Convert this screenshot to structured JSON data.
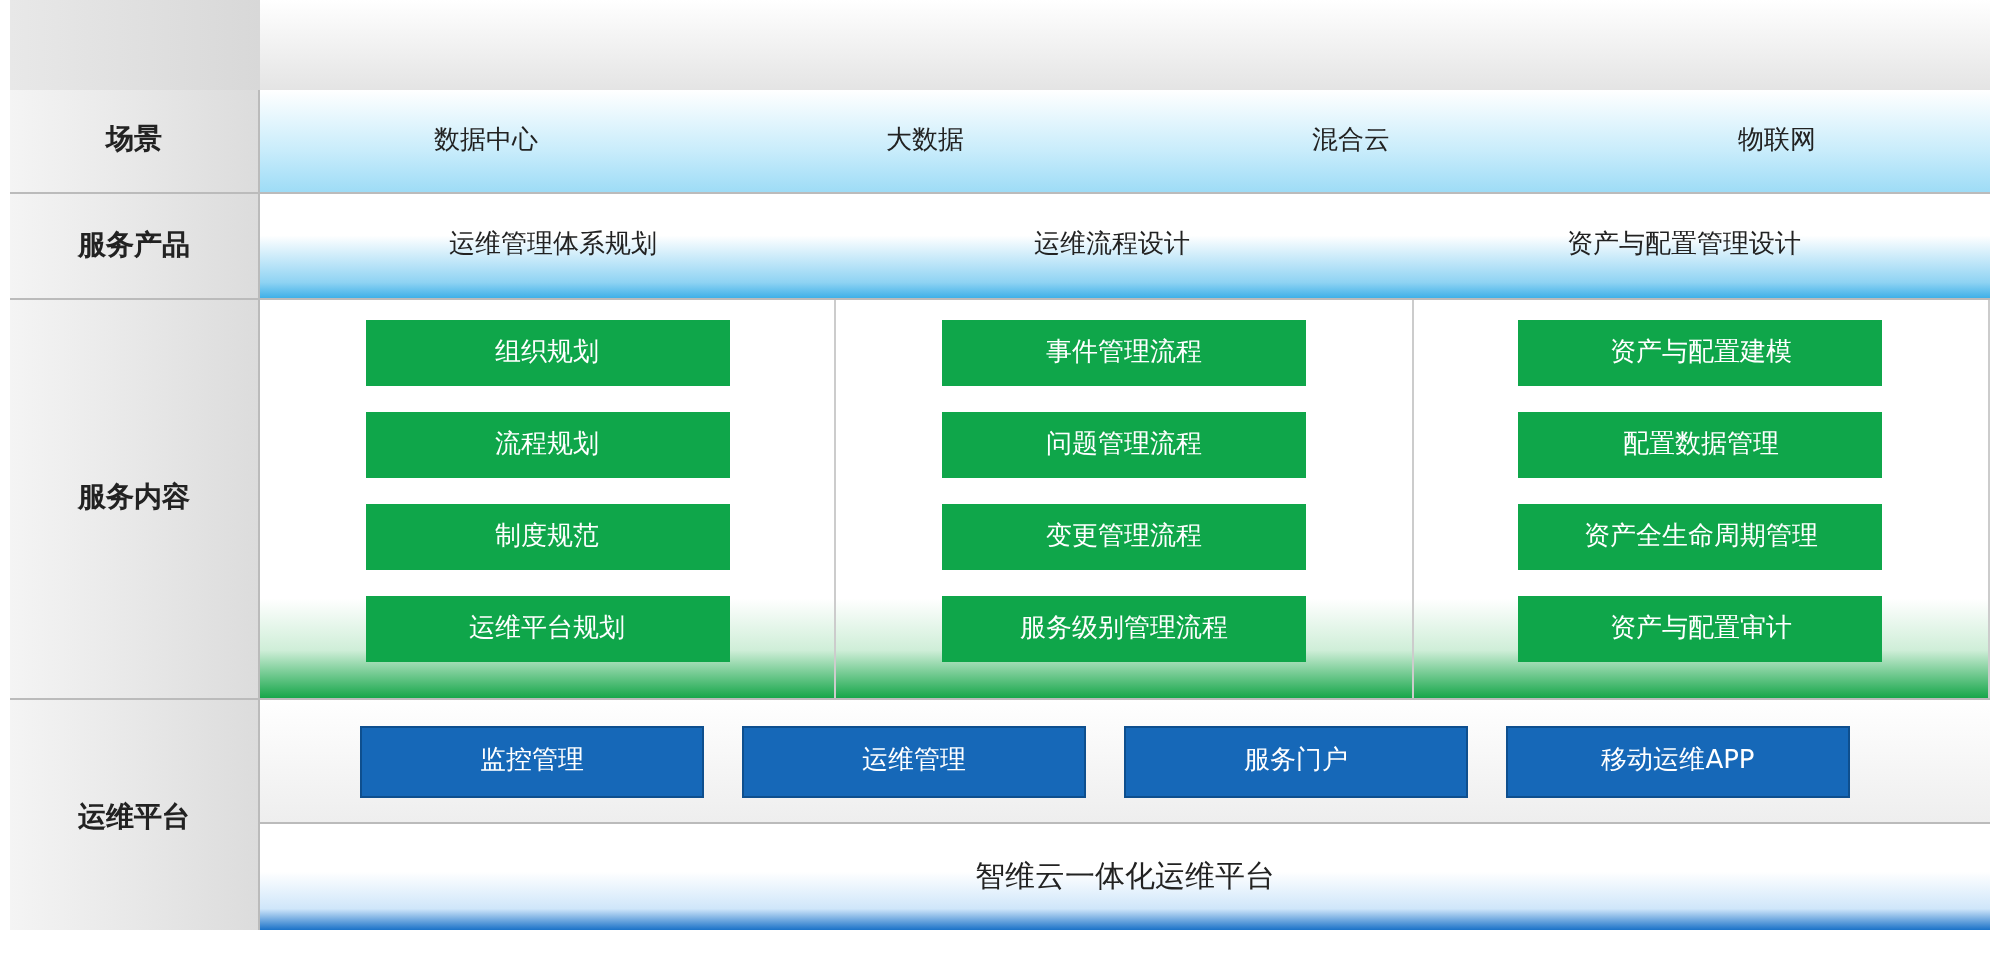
{
  "scene": {
    "label": "场景",
    "items": [
      "数据中心",
      "大数据",
      "混合云",
      "物联网"
    ]
  },
  "products": {
    "label": "服务产品",
    "items": [
      "运维管理体系规划",
      "运维流程设计",
      "资产与配置管理设计"
    ]
  },
  "content": {
    "label": "服务内容",
    "columns": [
      {
        "items": [
          "组织规划",
          "流程规划",
          "制度规范",
          "运维平台规划"
        ]
      },
      {
        "items": [
          "事件管理流程",
          "问题管理流程",
          "变更管理流程",
          "服务级别管理流程"
        ]
      },
      {
        "items": [
          "资产与配置建模",
          "配置数据管理",
          "资产全生命周期管理",
          "资产与配置审计"
        ]
      }
    ]
  },
  "platform": {
    "label": "运维平台",
    "modules": [
      "监控管理",
      "运维管理",
      "服务门户",
      "移动运维APP"
    ],
    "base": "智维云一体化运维平台"
  }
}
